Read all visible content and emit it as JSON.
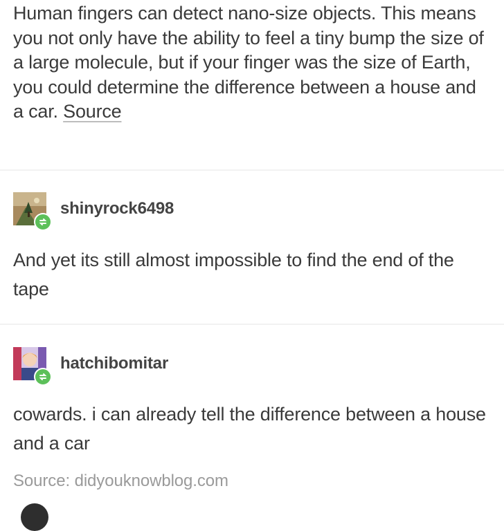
{
  "original_post": {
    "text": "Human fingers can detect nano-size  objects. This means you not only  have the ability to feel a tiny bump  the size of a large molecule, but if  your finger was the size of Earth,  you could determine the difference  between a house and a car. ",
    "source_link": "Source"
  },
  "reblogs": [
    {
      "username": "shinyrock6498",
      "text": "And yet its still almost impossible to find the end of the tape",
      "avatar_icon": "mountain-tree-avatar"
    },
    {
      "username": "hatchibomitar",
      "text": "cowards. i can already tell the difference between a house and a car",
      "avatar_icon": "anime-character-avatar"
    }
  ],
  "footer": {
    "source": "Source: didyouknowblog.com"
  },
  "colors": {
    "text": "#3a3a3a",
    "username": "#444444",
    "muted": "#9a9a9a",
    "reblog_badge": "#5cc05a",
    "divider": "#f2f2f2"
  }
}
